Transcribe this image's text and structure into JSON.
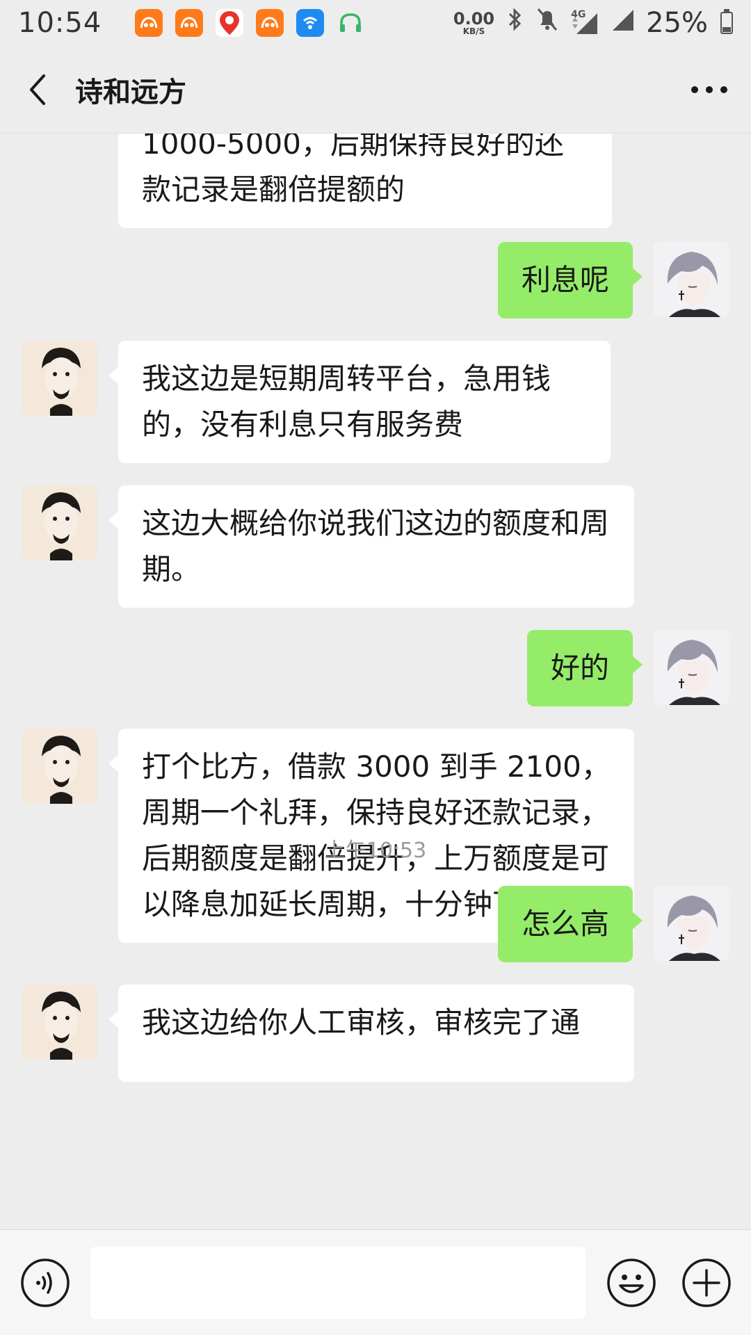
{
  "status_bar": {
    "time": "10:54",
    "net_speed_value": "0.00",
    "net_speed_unit": "KB/S",
    "signal_label": "4G",
    "battery_percent": "25%",
    "app_icons": [
      "uc-browser-icon",
      "uc-browser-icon",
      "baidu-map-icon",
      "uc-browser-icon",
      "wifi-app-icon",
      "headphones-icon"
    ]
  },
  "nav": {
    "title": "诗和远方"
  },
  "messages": [
    {
      "side": "left",
      "text": "1000-5000，后期保持良好的还款记录是翻倍提额的",
      "cut_top": true
    },
    {
      "side": "right",
      "text": "利息呢"
    },
    {
      "side": "left",
      "text": "我这边是短期周转平台，急用钱的，没有利息只有服务费"
    },
    {
      "side": "left",
      "text": "这边大概给你说我们这边的额度和周期。"
    },
    {
      "side": "right",
      "text": "好的"
    },
    {
      "side": "left",
      "text": "打个比方，借款 3000 到手 2100，周期一个礼拜，保持良好还款记录，后期额度是翻倍提升，上万额度是可以降息加延长周期，十分钟下款。"
    },
    {
      "side": "right",
      "text": "怎么高"
    },
    {
      "side": "left",
      "text": "我这边给你人工审核，审核完了通",
      "cut_bottom": true
    }
  ],
  "timestamp": "上午10:53",
  "input": {
    "value": "",
    "placeholder": ""
  },
  "colors": {
    "background": "#ededed",
    "sent_bubble": "#95ec69",
    "received_bubble": "#ffffff",
    "timestamp_text": "#9a9a9a"
  }
}
